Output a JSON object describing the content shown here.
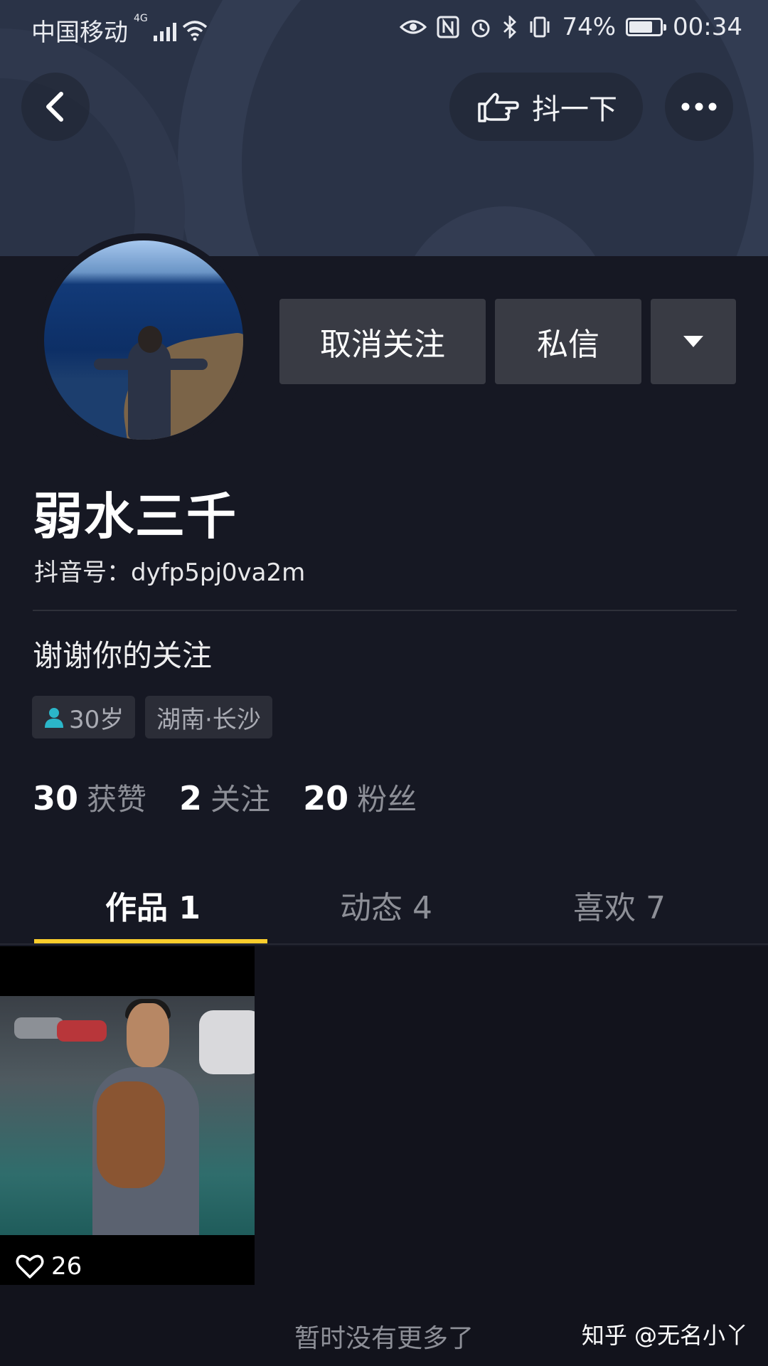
{
  "status_bar": {
    "carrier": "中国移动",
    "network": "4G",
    "battery": "74%",
    "time": "00:34"
  },
  "header": {
    "poke_label": "抖一下"
  },
  "profile": {
    "actions": {
      "unfollow": "取消关注",
      "message": "私信"
    },
    "nickname": "弱水三千",
    "douyin_id": "抖音号：dyfp5pj0va2m",
    "bio": "谢谢你的关注",
    "tags": {
      "age": "30岁",
      "location": "湖南·长沙"
    },
    "stats": [
      {
        "num": "30",
        "label": "获赞"
      },
      {
        "num": "2",
        "label": "关注"
      },
      {
        "num": "20",
        "label": "粉丝"
      }
    ]
  },
  "tabs": [
    {
      "label": "作品 1"
    },
    {
      "label": "动态 4"
    },
    {
      "label": "喜欢 7"
    }
  ],
  "videos": [
    {
      "likes": "26"
    }
  ],
  "footer": {
    "no_more": "暂时没有更多了",
    "watermark": "知乎 @无名小丫"
  },
  "colors": {
    "background": "#161823",
    "tab_indicator": "#facd2c",
    "button": "#393b44"
  }
}
